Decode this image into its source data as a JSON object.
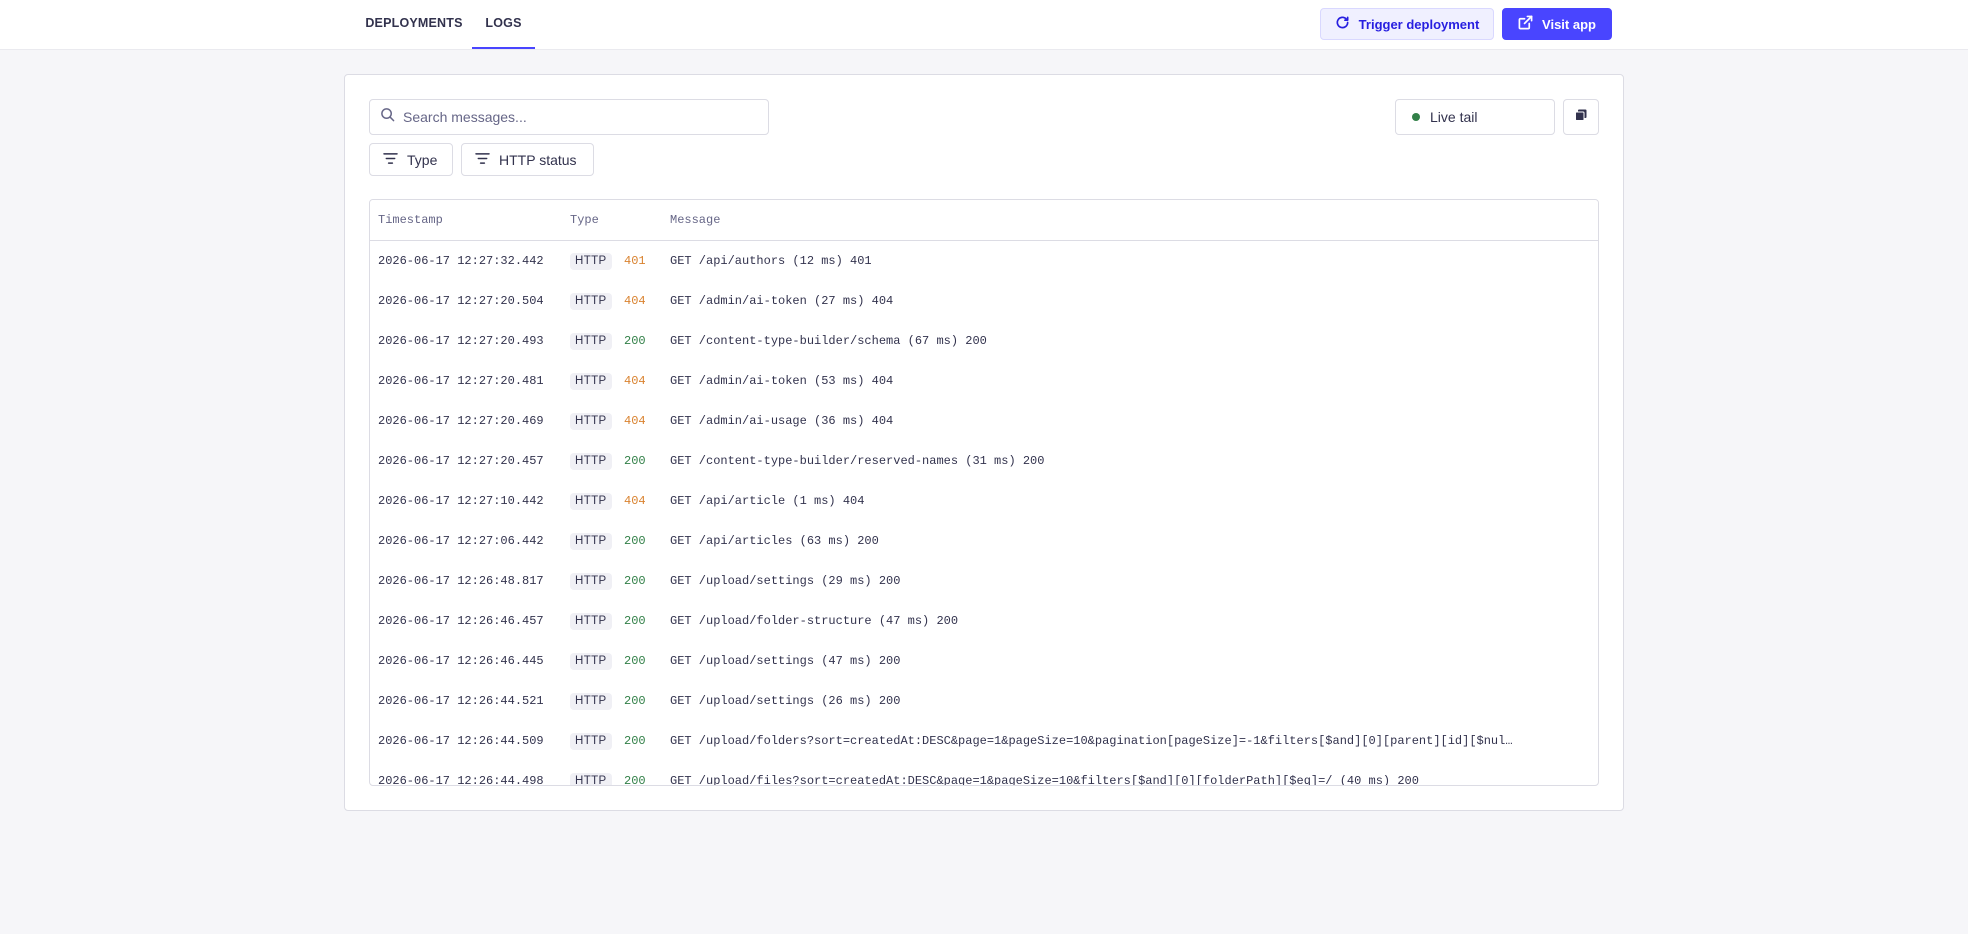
{
  "nav": {
    "tabs": [
      {
        "label": "DEPLOYMENTS"
      },
      {
        "label": "LOGS"
      }
    ]
  },
  "actions": {
    "trigger_label": "Trigger deployment",
    "visit_label": "Visit app"
  },
  "search": {
    "placeholder": "Search messages..."
  },
  "filters": {
    "type_label": "Type",
    "http_label": "HTTP status"
  },
  "live_tail": {
    "label": "Live tail",
    "status_color": "#328048"
  },
  "log_table": {
    "columns": [
      "Timestamp",
      "Type",
      "Message"
    ],
    "rows": [
      {
        "timestamp": "2026-06-17 12:27:32.442",
        "type": "HTTP",
        "status": "401",
        "message": "GET /api/authors (12 ms) 401"
      },
      {
        "timestamp": "2026-06-17 12:27:20.504",
        "type": "HTTP",
        "status": "404",
        "message": "GET /admin/ai-token (27 ms) 404"
      },
      {
        "timestamp": "2026-06-17 12:27:20.493",
        "type": "HTTP",
        "status": "200",
        "message": "GET /content-type-builder/schema (67 ms) 200"
      },
      {
        "timestamp": "2026-06-17 12:27:20.481",
        "type": "HTTP",
        "status": "404",
        "message": "GET /admin/ai-token (53 ms) 404"
      },
      {
        "timestamp": "2026-06-17 12:27:20.469",
        "type": "HTTP",
        "status": "404",
        "message": "GET /admin/ai-usage (36 ms) 404"
      },
      {
        "timestamp": "2026-06-17 12:27:20.457",
        "type": "HTTP",
        "status": "200",
        "message": "GET /content-type-builder/reserved-names (31 ms) 200"
      },
      {
        "timestamp": "2026-06-17 12:27:10.442",
        "type": "HTTP",
        "status": "404",
        "message": "GET /api/article (1 ms) 404"
      },
      {
        "timestamp": "2026-06-17 12:27:06.442",
        "type": "HTTP",
        "status": "200",
        "message": "GET /api/articles (63 ms) 200"
      },
      {
        "timestamp": "2026-06-17 12:26:48.817",
        "type": "HTTP",
        "status": "200",
        "message": "GET /upload/settings (29 ms) 200"
      },
      {
        "timestamp": "2026-06-17 12:26:46.457",
        "type": "HTTP",
        "status": "200",
        "message": "GET /upload/folder-structure (47 ms) 200"
      },
      {
        "timestamp": "2026-06-17 12:26:46.445",
        "type": "HTTP",
        "status": "200",
        "message": "GET /upload/settings (47 ms) 200"
      },
      {
        "timestamp": "2026-06-17 12:26:44.521",
        "type": "HTTP",
        "status": "200",
        "message": "GET /upload/settings (26 ms) 200"
      },
      {
        "timestamp": "2026-06-17 12:26:44.509",
        "type": "HTTP",
        "status": "200",
        "message": "GET /upload/folders?sort=createdAt:DESC&page=1&pageSize=10&pagination[pageSize]=-1&filters[$and][0][parent][id][$nul…"
      },
      {
        "timestamp": "2026-06-17 12:26:44.498",
        "type": "HTTP",
        "status": "200",
        "message": "GET /upload/files?sort=createdAt:DESC&page=1&pageSize=10&filters[$and][0][folderPath][$eq]=/ (40 ms) 200"
      }
    ]
  },
  "colors": {
    "accent": "#4945ff",
    "success": "#328048",
    "warning": "#d9822f"
  }
}
